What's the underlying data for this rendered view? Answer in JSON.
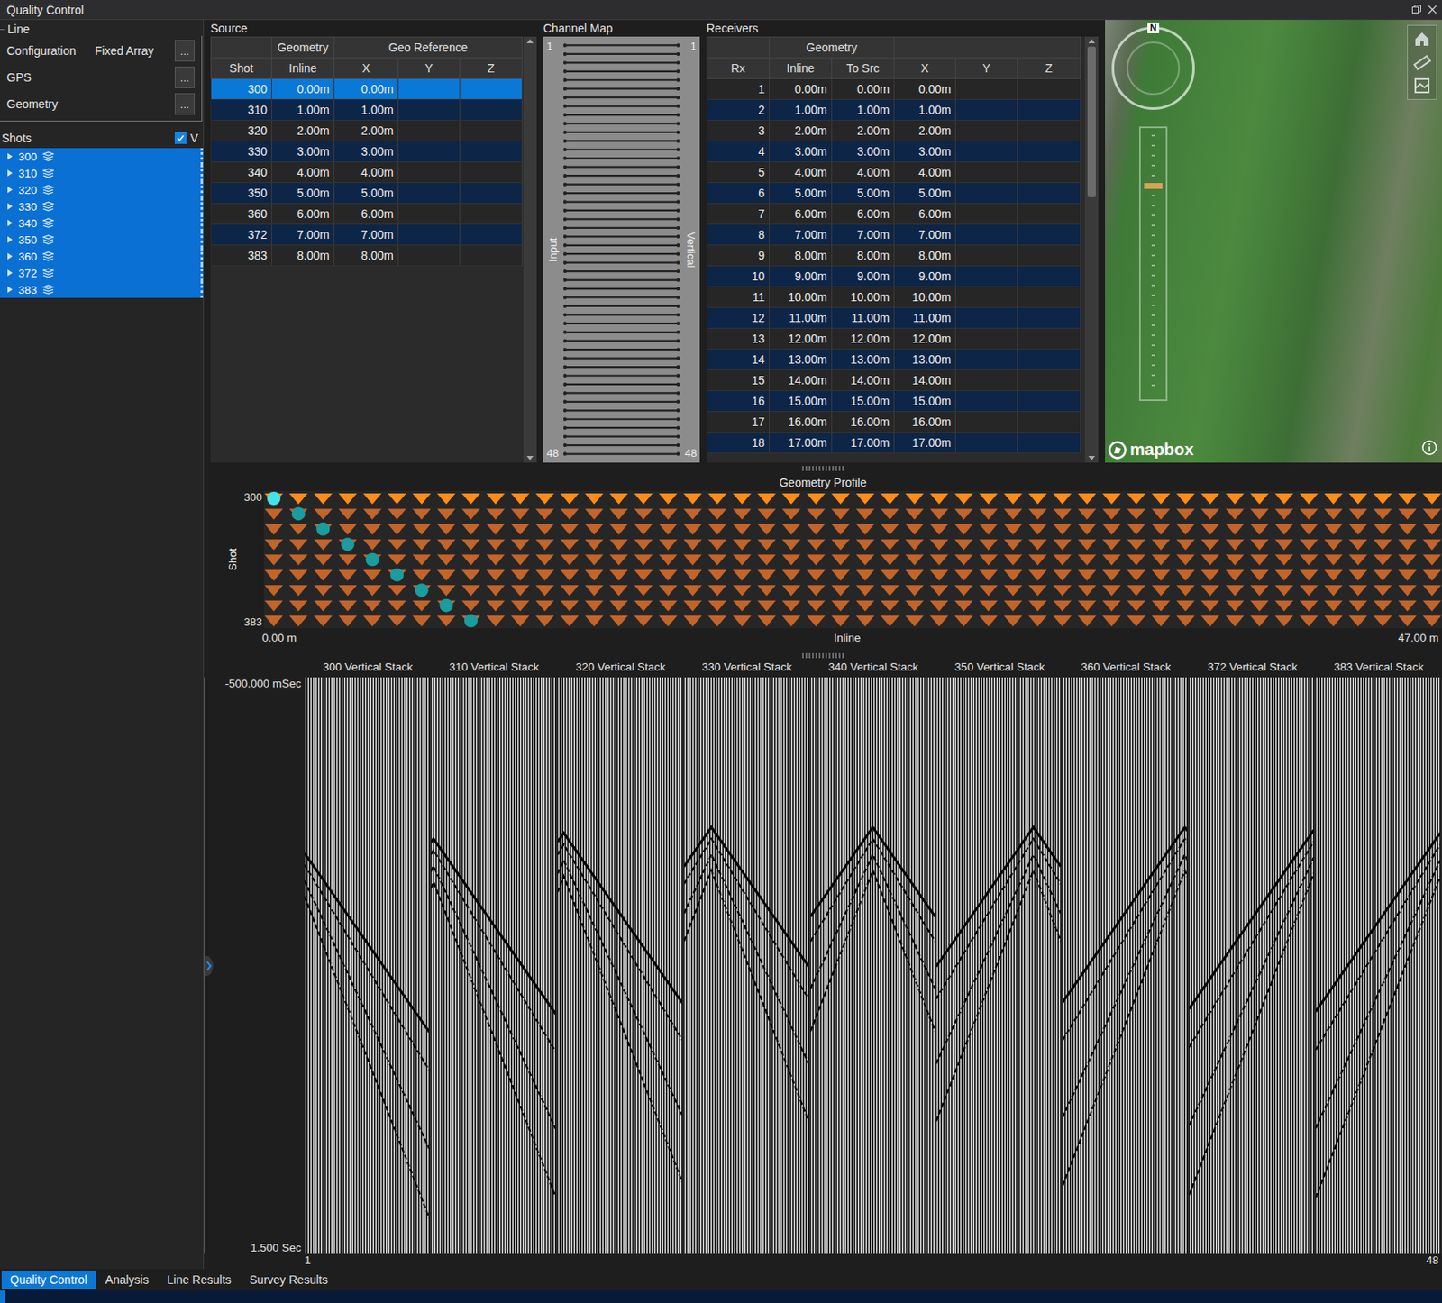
{
  "window": {
    "title": "Quality Control"
  },
  "line": {
    "label": "Line",
    "rows": [
      {
        "label": "Configuration",
        "value": "Fixed Array",
        "button": "..."
      },
      {
        "label": "GPS",
        "value": "",
        "button": "..."
      },
      {
        "label": "Geometry",
        "value": "",
        "button": "..."
      }
    ]
  },
  "shots": {
    "label": "Shots",
    "toggle": {
      "label": "V",
      "checked": true
    },
    "items": [
      {
        "label": "300",
        "selected": true,
        "expanded": false
      },
      {
        "label": "310",
        "selected": true,
        "expanded": false
      },
      {
        "label": "320",
        "selected": true,
        "expanded": false
      },
      {
        "label": "330",
        "selected": true,
        "expanded": false
      },
      {
        "label": "340",
        "selected": true,
        "expanded": false
      },
      {
        "label": "350",
        "selected": true,
        "expanded": false
      },
      {
        "label": "360",
        "selected": true,
        "expanded": false
      },
      {
        "label": "372",
        "selected": true,
        "expanded": false
      },
      {
        "label": "383",
        "selected": true,
        "expanded": false
      }
    ]
  },
  "source": {
    "title": "Source",
    "groups": [
      {
        "label": "",
        "columns": [
          "Shot"
        ]
      },
      {
        "label": "Geometry",
        "columns": [
          "Inline"
        ]
      },
      {
        "label": "Geo Reference",
        "columns": [
          "X",
          "Y",
          "Z"
        ]
      }
    ],
    "rows": [
      {
        "cells": [
          "300",
          "0.00m",
          "0.00m",
          "",
          ""
        ],
        "selected": true
      },
      {
        "cells": [
          "310",
          "1.00m",
          "1.00m",
          "",
          ""
        ],
        "selected": false
      },
      {
        "cells": [
          "320",
          "2.00m",
          "2.00m",
          "",
          ""
        ],
        "selected": false
      },
      {
        "cells": [
          "330",
          "3.00m",
          "3.00m",
          "",
          ""
        ],
        "selected": false
      },
      {
        "cells": [
          "340",
          "4.00m",
          "4.00m",
          "",
          ""
        ],
        "selected": false
      },
      {
        "cells": [
          "350",
          "5.00m",
          "5.00m",
          "",
          ""
        ],
        "selected": false
      },
      {
        "cells": [
          "360",
          "6.00m",
          "6.00m",
          "",
          ""
        ],
        "selected": false
      },
      {
        "cells": [
          "372",
          "7.00m",
          "7.00m",
          "",
          ""
        ],
        "selected": false
      },
      {
        "cells": [
          "383",
          "8.00m",
          "8.00m",
          "",
          ""
        ],
        "selected": false
      }
    ]
  },
  "channel_map": {
    "title": "Channel Map",
    "input_label": "Input",
    "output_label": "Vertical",
    "top_left": "1",
    "top_right": "1",
    "bottom_left": "48",
    "bottom_right": "48",
    "connections": [
      1,
      2,
      3,
      4,
      5,
      6,
      7,
      8,
      9,
      10,
      11,
      12,
      13,
      14,
      15,
      16,
      17,
      18,
      19,
      20,
      21,
      22,
      23,
      24,
      25,
      26,
      27,
      28,
      29,
      30,
      31,
      32,
      33,
      34,
      35,
      36,
      37,
      38,
      39,
      40,
      41,
      42,
      43,
      44,
      45,
      46,
      47,
      48
    ]
  },
  "receivers": {
    "title": "Receivers",
    "groups": [
      {
        "label": "",
        "columns": [
          "Rx"
        ]
      },
      {
        "label": "Geometry",
        "columns": [
          "Inline",
          "To Src"
        ]
      },
      {
        "label": "",
        "columns": [
          "X",
          "Y",
          "Z"
        ]
      }
    ],
    "scroll": {
      "start": 0,
      "size": 0.37
    },
    "rows": [
      {
        "cells": [
          "1",
          "0.00m",
          "0.00m",
          "0.00m",
          "",
          ""
        ]
      },
      {
        "cells": [
          "2",
          "1.00m",
          "1.00m",
          "1.00m",
          "",
          ""
        ]
      },
      {
        "cells": [
          "3",
          "2.00m",
          "2.00m",
          "2.00m",
          "",
          ""
        ]
      },
      {
        "cells": [
          "4",
          "3.00m",
          "3.00m",
          "3.00m",
          "",
          ""
        ]
      },
      {
        "cells": [
          "5",
          "4.00m",
          "4.00m",
          "4.00m",
          "",
          ""
        ]
      },
      {
        "cells": [
          "6",
          "5.00m",
          "5.00m",
          "5.00m",
          "",
          ""
        ]
      },
      {
        "cells": [
          "7",
          "6.00m",
          "6.00m",
          "6.00m",
          "",
          ""
        ]
      },
      {
        "cells": [
          "8",
          "7.00m",
          "7.00m",
          "7.00m",
          "",
          ""
        ]
      },
      {
        "cells": [
          "9",
          "8.00m",
          "8.00m",
          "8.00m",
          "",
          ""
        ]
      },
      {
        "cells": [
          "10",
          "9.00m",
          "9.00m",
          "9.00m",
          "",
          ""
        ]
      },
      {
        "cells": [
          "11",
          "10.00m",
          "10.00m",
          "10.00m",
          "",
          ""
        ]
      },
      {
        "cells": [
          "12",
          "11.00m",
          "11.00m",
          "11.00m",
          "",
          ""
        ]
      },
      {
        "cells": [
          "13",
          "12.00m",
          "12.00m",
          "12.00m",
          "",
          ""
        ]
      },
      {
        "cells": [
          "14",
          "13.00m",
          "13.00m",
          "13.00m",
          "",
          ""
        ]
      },
      {
        "cells": [
          "15",
          "14.00m",
          "14.00m",
          "14.00m",
          "",
          ""
        ]
      },
      {
        "cells": [
          "16",
          "15.00m",
          "15.00m",
          "15.00m",
          "",
          ""
        ]
      },
      {
        "cells": [
          "17",
          "16.00m",
          "16.00m",
          "16.00m",
          "",
          ""
        ]
      },
      {
        "cells": [
          "18",
          "17.00m",
          "17.00m",
          "17.00m",
          "",
          ""
        ]
      }
    ]
  },
  "map": {
    "compass": "N",
    "attribution": "mapbox"
  },
  "profile": {
    "title": "Geometry Profile",
    "y_label": "Shot",
    "y_ticks": [
      "300",
      "383"
    ],
    "x_ticks": [
      "0.00 m",
      "47.00 m"
    ],
    "x_label": "Inline",
    "x_max_m": 47,
    "receiver_m": [
      0,
      1,
      2,
      3,
      4,
      5,
      6,
      7,
      8,
      9,
      10,
      11,
      12,
      13,
      14,
      15,
      16,
      17,
      18,
      19,
      20,
      21,
      22,
      23,
      24,
      25,
      26,
      27,
      28,
      29,
      30,
      31,
      32,
      33,
      34,
      35,
      36,
      37,
      38,
      39,
      40,
      41,
      42,
      43,
      44,
      45,
      46,
      47
    ]
  },
  "seismic": {
    "time_top": "-500.000 mSec",
    "time_bottom": "1.500 Sec",
    "t_min_ms": -500,
    "t_max_ms": 1500,
    "trace_first": "1",
    "trace_last": "48",
    "trace_count": 48,
    "panels": [
      {
        "label": "300 Vertical Stack",
        "apex": 0,
        "apex_ms": 110
      },
      {
        "label": "310 Vertical Stack",
        "apex": 0.02,
        "apex_ms": 60
      },
      {
        "label": "320 Vertical Stack",
        "apex": 0.05,
        "apex_ms": 40
      },
      {
        "label": "330 Vertical Stack",
        "apex": 0.22,
        "apex_ms": 20
      },
      {
        "label": "340 Vertical Stack",
        "apex": 0.5,
        "apex_ms": 20
      },
      {
        "label": "350 Vertical Stack",
        "apex": 0.78,
        "apex_ms": 20
      },
      {
        "label": "360 Vertical Stack",
        "apex": 0.98,
        "apex_ms": 20
      },
      {
        "label": "372 Vertical Stack",
        "apex": 1,
        "apex_ms": 30
      },
      {
        "label": "383 Vertical Stack",
        "apex": 1,
        "apex_ms": 40
      }
    ]
  },
  "tabs": [
    {
      "label": "Quality Control",
      "selected": true
    },
    {
      "label": "Analysis",
      "selected": false
    },
    {
      "label": "Line Results",
      "selected": false
    },
    {
      "label": "Survey Results",
      "selected": false
    }
  ]
}
